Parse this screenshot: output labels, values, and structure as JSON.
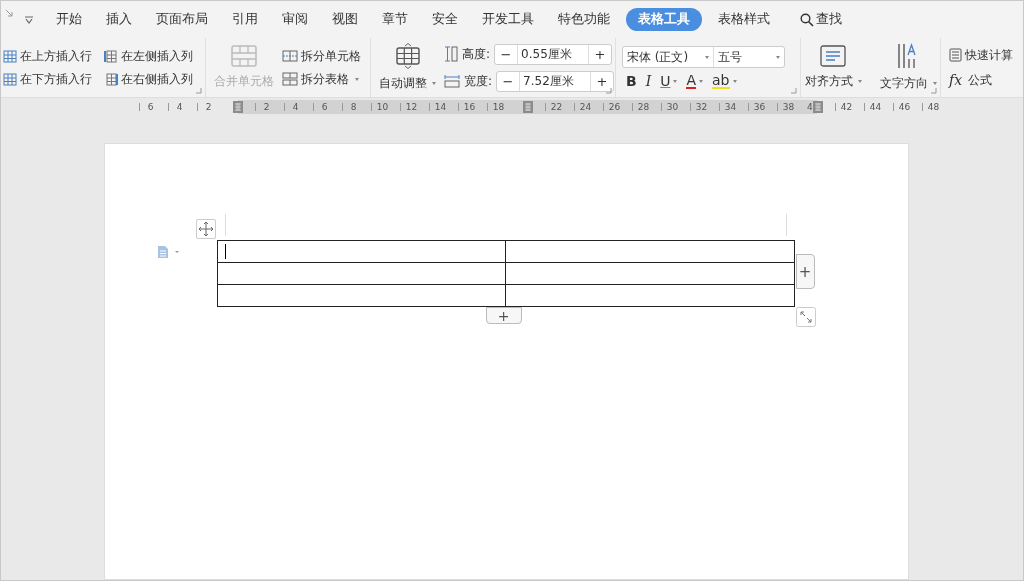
{
  "tabs": [
    {
      "label": "开始",
      "selected": false
    },
    {
      "label": "插入",
      "selected": false
    },
    {
      "label": "页面布局",
      "selected": false
    },
    {
      "label": "引用",
      "selected": false
    },
    {
      "label": "审阅",
      "selected": false
    },
    {
      "label": "视图",
      "selected": false
    },
    {
      "label": "章节",
      "selected": false
    },
    {
      "label": "安全",
      "selected": false
    },
    {
      "label": "开发工具",
      "selected": false
    },
    {
      "label": "特色功能",
      "selected": false
    },
    {
      "label": "表格工具",
      "selected": true
    },
    {
      "label": "表格样式",
      "selected": false
    }
  ],
  "search": {
    "label": "查找"
  },
  "ribbon": {
    "insert_buttons": [
      "在上方插入行",
      "在左侧插入列",
      "在下方插入行",
      "在右侧插入列"
    ],
    "merge": {
      "label": "合并单元格",
      "disabled": true
    },
    "split_buttons": [
      {
        "label": "拆分单元格",
        "dropdown": false
      },
      {
        "label": "拆分表格",
        "dropdown": true
      }
    ],
    "autofit": {
      "label": "自动调整"
    },
    "size_fields": [
      {
        "label": "高度:",
        "value": "0.55厘米",
        "minus": "−",
        "plus": "+"
      },
      {
        "label": "宽度:",
        "value": "7.52厘米",
        "minus": "−",
        "plus": "+"
      }
    ],
    "font": {
      "family": "宋体 (正文)",
      "size": "五号"
    },
    "format_buttons": [
      {
        "kind": "bold",
        "label": "B",
        "dropdown": false
      },
      {
        "kind": "italic",
        "label": "I",
        "dropdown": false
      },
      {
        "kind": "underline",
        "label": "U",
        "dropdown": true
      },
      {
        "kind": "font-color",
        "label": "A",
        "dropdown": true,
        "color": "#e02020"
      },
      {
        "kind": "highlight",
        "label": "ab",
        "dropdown": true,
        "color": "#f2e21c"
      }
    ],
    "align": {
      "label": "对齐方式"
    },
    "direction": {
      "label": "文字方向"
    },
    "quick_calc": {
      "label": "快速计算"
    },
    "formula": {
      "symbol": "fx",
      "label": "公式"
    }
  },
  "ruler": [
    {
      "kind": "number",
      "label": "6"
    },
    {
      "kind": "number",
      "label": "4"
    },
    {
      "kind": "number",
      "label": "2"
    },
    {
      "kind": "marker"
    },
    {
      "kind": "number",
      "label": "2"
    },
    {
      "kind": "number",
      "label": "4"
    },
    {
      "kind": "number",
      "label": "6"
    },
    {
      "kind": "number",
      "label": "8"
    },
    {
      "kind": "number",
      "label": "10"
    },
    {
      "kind": "number",
      "label": "12"
    },
    {
      "kind": "number",
      "label": "14"
    },
    {
      "kind": "number",
      "label": "16"
    },
    {
      "kind": "number",
      "label": "18"
    },
    {
      "kind": "marker"
    },
    {
      "kind": "number",
      "label": "22"
    },
    {
      "kind": "number",
      "label": "24"
    },
    {
      "kind": "number",
      "label": "26"
    },
    {
      "kind": "number",
      "label": "28"
    },
    {
      "kind": "number",
      "label": "30"
    },
    {
      "kind": "number",
      "label": "32"
    },
    {
      "kind": "number",
      "label": "34"
    },
    {
      "kind": "number",
      "label": "36"
    },
    {
      "kind": "number",
      "label": "38"
    },
    {
      "kind": "marker",
      "label": "4"
    },
    {
      "kind": "number",
      "label": "42"
    },
    {
      "kind": "number",
      "label": "44"
    },
    {
      "kind": "number",
      "label": "46"
    },
    {
      "kind": "number",
      "label": "48"
    }
  ],
  "table": {
    "rows": [
      {
        "cells": [
          {
            "cursor": true
          },
          {
            "cursor": false
          }
        ]
      },
      {
        "cells": [
          {
            "cursor": false
          },
          {
            "cursor": false
          }
        ]
      },
      {
        "cells": [
          {
            "cursor": false
          },
          {
            "cursor": false
          }
        ]
      }
    ],
    "add_row": "+",
    "add_column": "+"
  }
}
